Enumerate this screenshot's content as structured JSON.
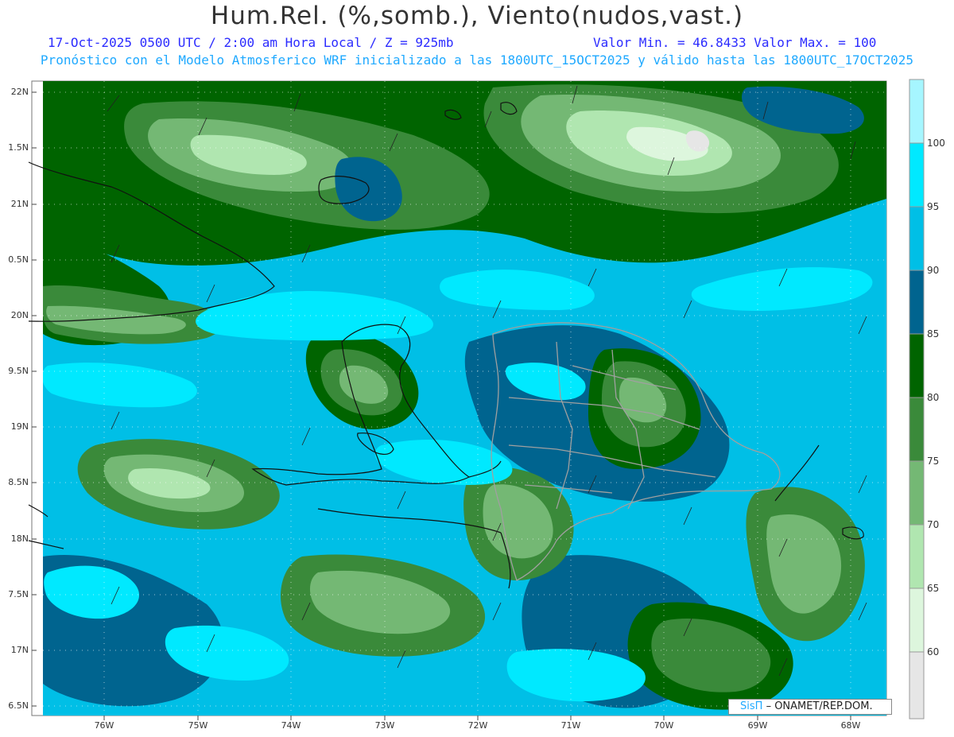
{
  "header": {
    "title": "Hum.Rel. (%,somb.), Viento(nudos,vast.)",
    "line1_left": "17-Oct-2025  0500 UTC / 2:00 am Hora Local / Z = 925mb",
    "line1_right": "Valor Min. = 46.8433  Valor Max. = 100",
    "line2": "Pronóstico con el Modelo Atmosferico WRF inicializado a las 1800UTC_15OCT2025 y válido hasta las  1800UTC_17OCT2025"
  },
  "map": {
    "lat_labels": [
      "22N",
      "1.5N",
      "21N",
      "0.5N",
      "20N",
      "9.5N",
      "19N",
      "8.5N",
      "18N",
      "7.5N",
      "17N",
      "6.5N"
    ],
    "lon_labels": [
      "76W",
      "75W",
      "74W",
      "73W",
      "72W",
      "71W",
      "70W",
      "69W",
      "68W"
    ]
  },
  "colorbar": {
    "labels": [
      "100",
      "95",
      "90",
      "85",
      "80",
      "75",
      "70",
      "65",
      "60"
    ],
    "colors": [
      "#a6f6ff",
      "#00e9ff",
      "#00bfe6",
      "#00648f",
      "#006400",
      "#3a8a3a",
      "#74b874",
      "#b0e6b0",
      "#ddf6dd",
      "#e6e6e6"
    ]
  },
  "credit": {
    "brand": "SisΠ",
    "text": "– ONAMET/REP.DOM."
  }
}
